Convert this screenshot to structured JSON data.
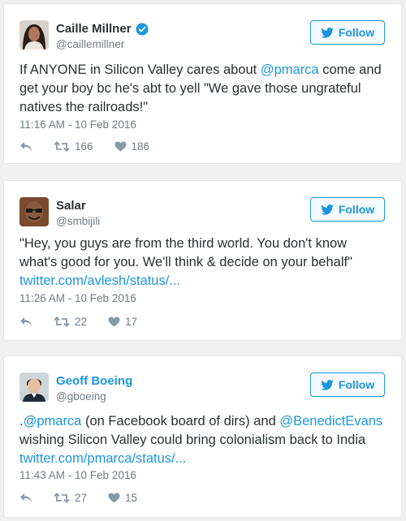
{
  "tweets": [
    {
      "name": "Caille Millner",
      "handle": "@caillemillner",
      "verified": true,
      "follow_label": "Follow",
      "text_parts": {
        "p1": "If ANYONE in Silicon Valley cares about ",
        "mention1": "@pmarca",
        "p2": " come and get your boy bc he's abt to yell \"We gave those ungrateful natives the railroads!\""
      },
      "timestamp": "11:16 AM - 10 Feb 2016",
      "retweets": "166",
      "likes": "186"
    },
    {
      "name": "Salar",
      "handle": "@smbijili",
      "verified": false,
      "follow_label": "Follow",
      "text_parts": {
        "p1": "\"Hey, you guys are from the third world. You don't know what's good for you. We'll think & decide on your behalf\"",
        "url": "twitter.com/avlesh/status/..."
      },
      "timestamp": "11:26 AM - 10 Feb 2016",
      "retweets": "22",
      "likes": "17"
    },
    {
      "name": "Geoff Boeing",
      "handle": "@gboeing",
      "verified": false,
      "follow_label": "Follow",
      "text_parts": {
        "p0": ".",
        "mention1": "@pmarca",
        "p1": " (on Facebook board of dirs) and ",
        "mention2": "@BenedictEvans",
        "p2": " wishing Silicon Valley could bring colonialism back to India",
        "url": "twitter.com/pmarca/status/..."
      },
      "timestamp": "11:43 AM - 10 Feb 2016",
      "retweets": "27",
      "likes": "15"
    }
  ],
  "colors": {
    "link": "#1b95e0",
    "muted": "#707c85",
    "text": "#292f33",
    "background": "#f0f0f0",
    "card_border": "#e1e8ed"
  },
  "icons": [
    "verified-badge-icon",
    "twitter-bird-icon",
    "reply-icon",
    "retweet-icon",
    "like-heart-icon"
  ]
}
